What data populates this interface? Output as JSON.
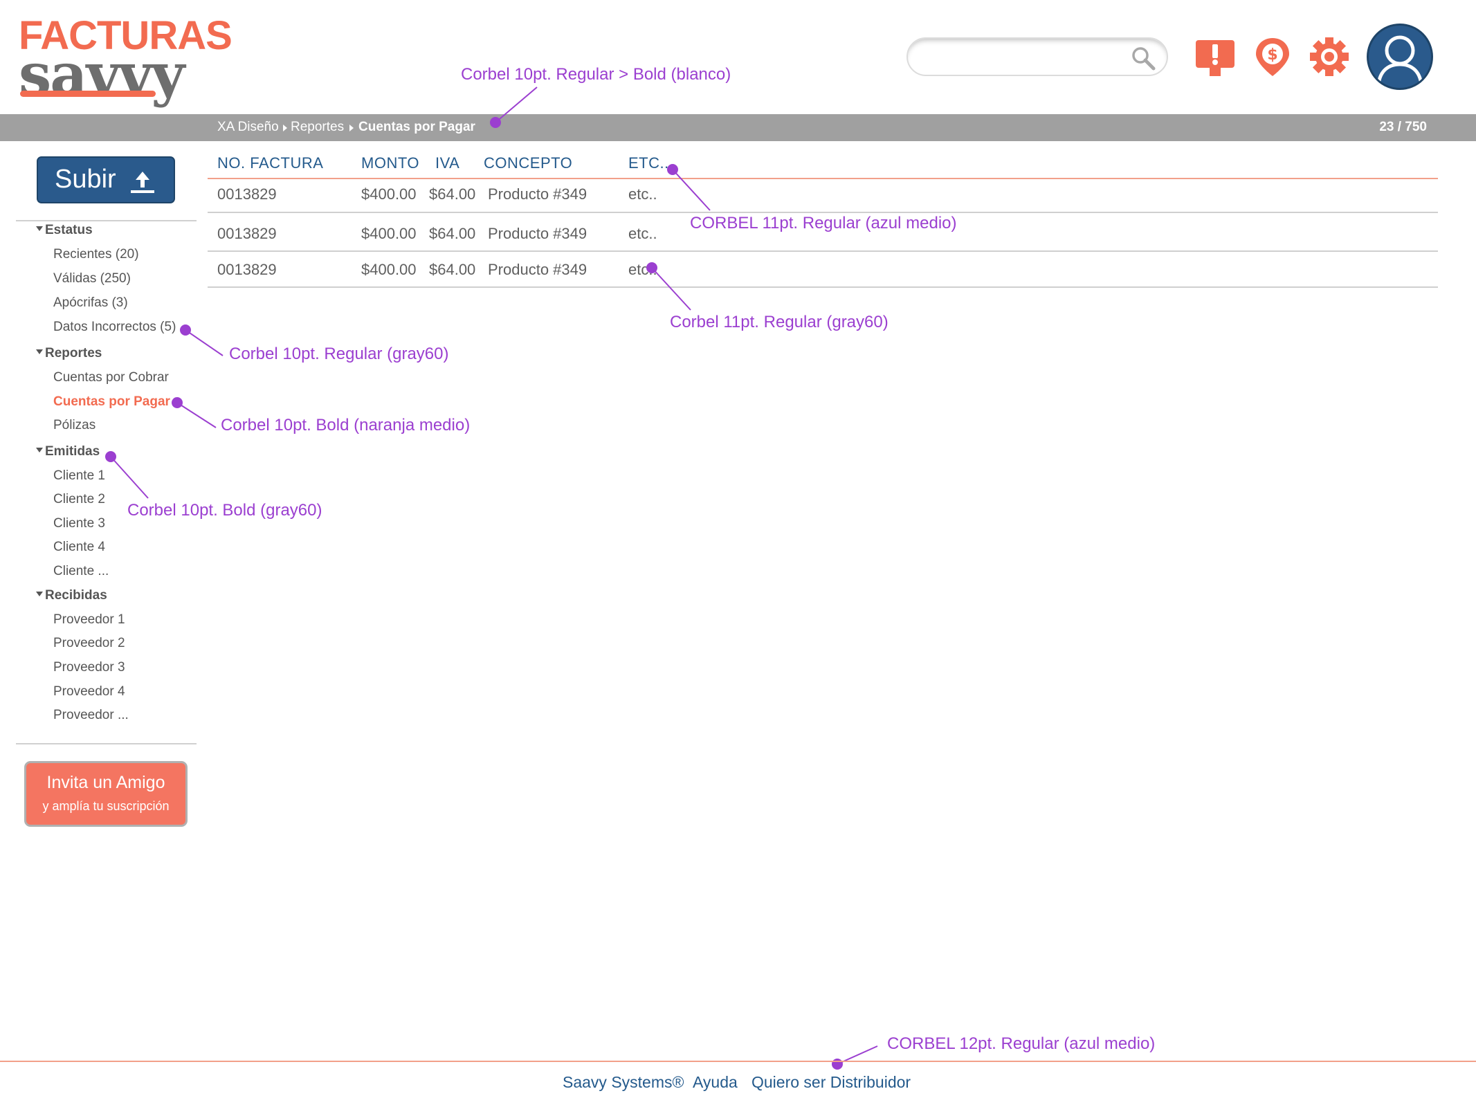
{
  "brand": {
    "top": "FACTURAS",
    "bottom": "savvy"
  },
  "search": {
    "placeholder": ""
  },
  "header_icons": [
    "alert-icon",
    "dollar-pin-icon",
    "gear-icon",
    "user-avatar-icon"
  ],
  "breadcrumb": {
    "items": [
      "XA Diseño",
      "Reportes",
      "Cuentas por Pagar"
    ],
    "counter": "23 / 750"
  },
  "sidebar": {
    "upload_label": "Subir",
    "sections": [
      {
        "title": "Estatus",
        "items": [
          "Recientes (20)",
          "Válidas (250)",
          "Apócrifas (3)",
          "Datos Incorrectos (5)"
        ]
      },
      {
        "title": "Reportes",
        "items": [
          "Cuentas por Cobrar",
          "Cuentas por Pagar",
          "Pólizas"
        ],
        "active_item": "Cuentas por Pagar"
      },
      {
        "title": "Emitidas",
        "items": [
          "Cliente 1",
          "Cliente 2",
          "Cliente 3",
          "Cliente 4",
          "Cliente ..."
        ]
      },
      {
        "title": "Recibidas",
        "items": [
          "Proveedor 1",
          "Proveedor 2",
          "Proveedor 3",
          "Proveedor 4",
          "Proveedor ..."
        ]
      }
    ],
    "invite": {
      "title": "Invita un Amigo",
      "subtitle": "y amplía tu suscripción"
    }
  },
  "table": {
    "columns": [
      "NO. FACTURA",
      "MONTO",
      "IVA",
      "CONCEPTO",
      "ETC.."
    ],
    "rows": [
      [
        "0013829",
        "$400.00",
        "$64.00",
        "Producto #349",
        "etc.."
      ],
      [
        "0013829",
        "$400.00",
        "$64.00",
        "Producto #349",
        "etc.."
      ],
      [
        "0013829",
        "$400.00",
        "$64.00",
        "Producto #349",
        "etc.."
      ]
    ]
  },
  "annotations": {
    "breadcrumb": "Corbel 10pt. Regular > Bold (blanco)",
    "table_header": "CORBEL 11pt. Regular (azul medio)",
    "table_cell": "Corbel 11pt. Regular (gray60)",
    "sidebar_item": "Corbel 10pt. Regular (gray60)",
    "sidebar_active": "Corbel 10pt. Bold (naranja medio)",
    "sidebar_section": "Corbel 10pt. Bold (gray60)",
    "footer": "CORBEL 12pt. Regular (azul medio)"
  },
  "footer": {
    "links": [
      "Saavy Systems®",
      "Ayuda",
      "Quiero ser Distribuidor"
    ]
  },
  "colors": {
    "orange": "#f26b50",
    "blue": "#245a8c",
    "gray60": "#5f5f5f",
    "bar": "#a0a0a0",
    "annotation": "#9b3fd0"
  }
}
